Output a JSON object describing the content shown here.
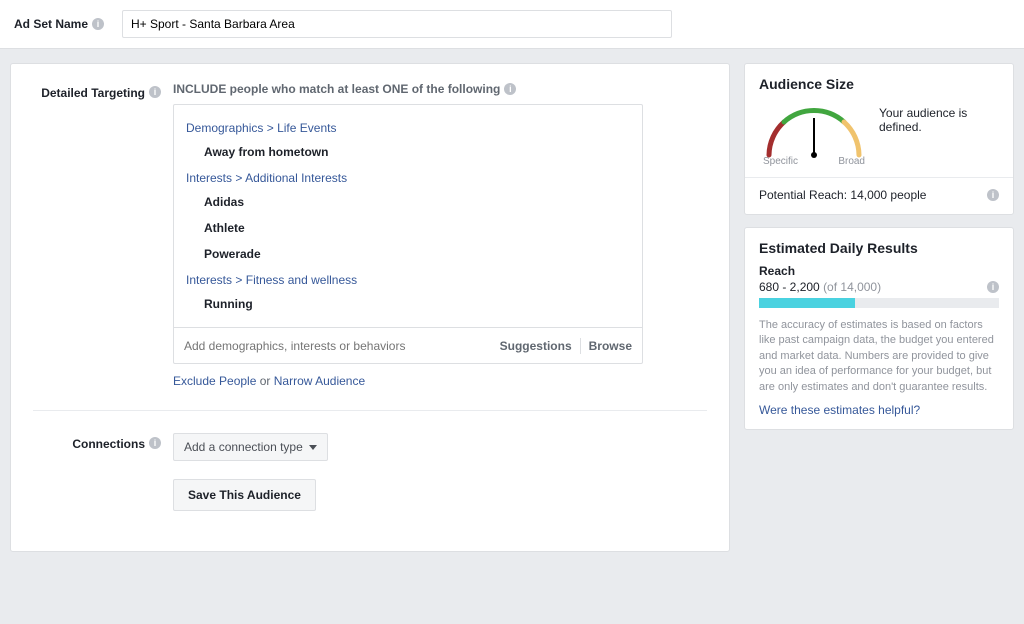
{
  "header": {
    "label": "Ad Set Name",
    "value": "H+ Sport - Santa Barbara Area"
  },
  "targeting": {
    "section_label": "Detailed Targeting",
    "include_text": "INCLUDE people who match at least ONE of the following",
    "groups": [
      {
        "path_a": "Demographics",
        "path_b": "Life Events",
        "items": [
          "Away from hometown"
        ]
      },
      {
        "path_a": "Interests",
        "path_b": "Additional Interests",
        "items": [
          "Adidas",
          "Athlete",
          "Powerade"
        ]
      },
      {
        "path_a": "Interests",
        "path_b": "Fitness and wellness",
        "items": [
          "Running"
        ]
      }
    ],
    "input_placeholder": "Add demographics, interests or behaviors",
    "suggestions_label": "Suggestions",
    "browse_label": "Browse",
    "exclude_label": "Exclude People",
    "or_label": "or",
    "narrow_label": "Narrow Audience"
  },
  "connections": {
    "section_label": "Connections",
    "button_label": "Add a connection type"
  },
  "save_button": "Save This Audience",
  "audience": {
    "title": "Audience Size",
    "specific": "Specific",
    "broad": "Broad",
    "message": "Your audience is defined.",
    "reach_label": "Potential Reach: 14,000 people"
  },
  "edr": {
    "title": "Estimated Daily Results",
    "reach_label": "Reach",
    "range": "680 - 2,200",
    "of": "(of 14,000)",
    "progress_pct": 40,
    "disclaimer": "The accuracy of estimates is based on factors like past campaign data, the budget you entered and market data. Numbers are provided to give you an idea of performance for your budget, but are only estimates and don't guarantee results.",
    "feedback": "Were these estimates helpful?"
  }
}
